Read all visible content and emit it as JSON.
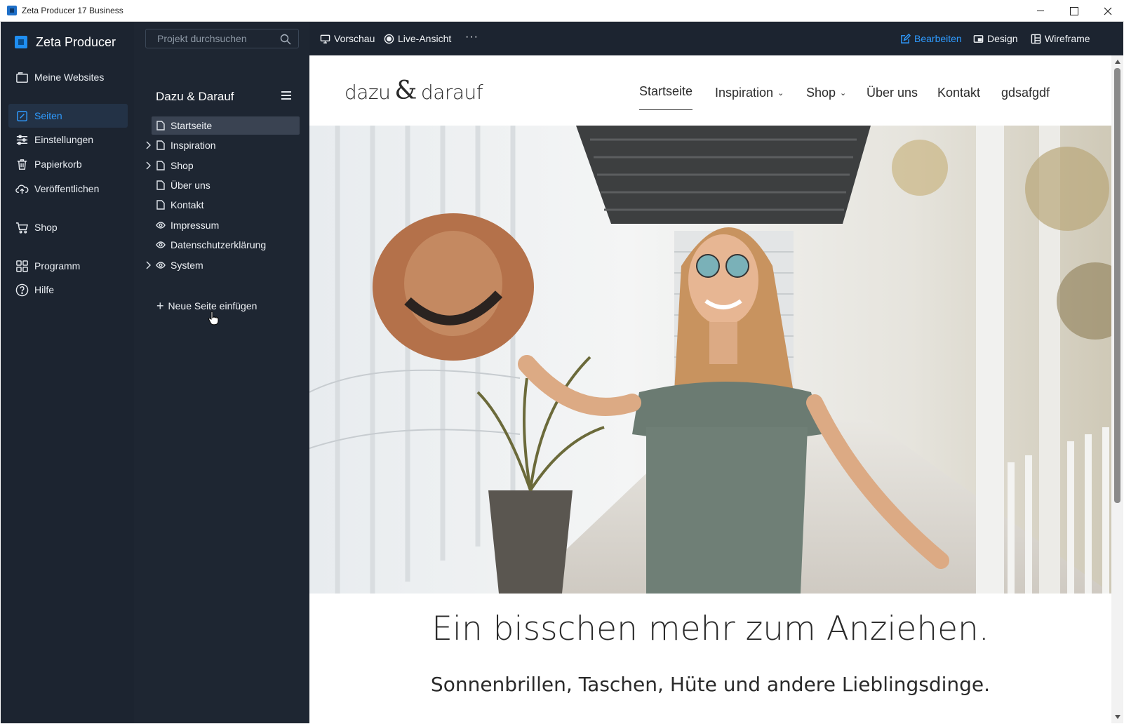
{
  "window": {
    "title": "Zeta Producer 17 Business"
  },
  "brand": {
    "name": "Zeta Producer"
  },
  "leftnav": {
    "items": [
      {
        "label": "Meine Websites",
        "icon": "websites-icon"
      },
      {
        "label": "Seiten",
        "icon": "pages-icon",
        "active": true
      },
      {
        "label": "Einstellungen",
        "icon": "settings-sliders-icon"
      },
      {
        "label": "Papierkorb",
        "icon": "trash-icon"
      },
      {
        "label": "Veröffentlichen",
        "icon": "cloud-upload-icon"
      },
      {
        "label": "Shop",
        "icon": "cart-icon"
      },
      {
        "label": "Programm",
        "icon": "grid-icon"
      },
      {
        "label": "Hilfe",
        "icon": "help-icon"
      }
    ]
  },
  "search": {
    "placeholder": "Projekt durchsuchen"
  },
  "panel": {
    "title": "Dazu & Darauf",
    "pages": [
      {
        "label": "Startseite",
        "icon": "page-icon",
        "expandable": false,
        "selected": true
      },
      {
        "label": "Inspiration",
        "icon": "page-icon",
        "expandable": true
      },
      {
        "label": "Shop",
        "icon": "page-icon",
        "expandable": true
      },
      {
        "label": "Über uns",
        "icon": "page-icon",
        "expandable": false
      },
      {
        "label": "Kontakt",
        "icon": "page-icon",
        "expandable": false
      },
      {
        "label": "Impressum",
        "icon": "eye-icon",
        "expandable": false
      },
      {
        "label": "Datenschutzerklärung",
        "icon": "eye-icon",
        "expandable": false
      },
      {
        "label": "System",
        "icon": "eye-icon",
        "expandable": true
      }
    ],
    "new_page": "Neue Seite einfügen"
  },
  "toolbar": {
    "preview": "Vorschau",
    "live": "Live-Ansicht",
    "more": "···",
    "edit": "Bearbeiten",
    "design": "Design",
    "wireframe": "Wireframe",
    "accent": "#2f9bff"
  },
  "site": {
    "logo_left": "dazu",
    "logo_amp": "&",
    "logo_right": "darauf",
    "nav": [
      {
        "label": "Startseite",
        "active": true
      },
      {
        "label": "Inspiration",
        "dropdown": true
      },
      {
        "label": "Shop",
        "dropdown": true
      },
      {
        "label": "Über uns"
      },
      {
        "label": "Kontakt"
      },
      {
        "label": "gdsafgdf"
      }
    ],
    "caret": "⌄",
    "headline": "Ein bisschen mehr zum Anziehen.",
    "subline": "Sonnenbrillen, Taschen, Hüte und andere Lieblingsdinge."
  },
  "colors": {
    "app_bg": "#1c2430",
    "panel_bg": "#1e2632",
    "selected_bg": "#3a4352"
  }
}
